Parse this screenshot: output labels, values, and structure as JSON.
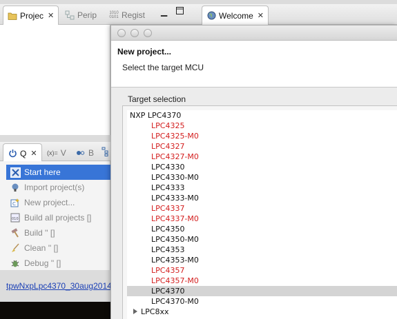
{
  "top_tabs": [
    {
      "label": "Projec",
      "icon": "folder-icon",
      "active": true
    },
    {
      "label": "Perip",
      "icon": "peripherals-icon",
      "active": false
    },
    {
      "label": "Regist",
      "icon": "registers-icon",
      "active": false
    }
  ],
  "welcome_tab": {
    "label": "Welcome",
    "icon": "globe-icon"
  },
  "q_tabs": [
    {
      "label": "Q",
      "icon": "power-icon"
    },
    {
      "label": "V",
      "icon": "variables-icon",
      "prefix": "(x)="
    },
    {
      "label": "B",
      "icon": "breakpoints-icon"
    }
  ],
  "quickstart": {
    "items": [
      {
        "label": "Start here",
        "icon": "start-icon",
        "selected": true
      },
      {
        "label": "Import project(s)",
        "icon": "import-icon"
      },
      {
        "label": "New project...",
        "icon": "new-project-icon"
      },
      {
        "label": "Build all projects []",
        "icon": "build-all-icon"
      },
      {
        "label": "Build '' []",
        "icon": "hammer-icon"
      },
      {
        "label": "Clean '' []",
        "icon": "broom-icon"
      },
      {
        "label": "Debug '' []",
        "icon": "bug-icon"
      }
    ]
  },
  "workspace_link": "tpwNxpLpc4370_30aug2014",
  "dialog": {
    "heading": "New project...",
    "subtitle": "Select the target MCU",
    "group_label": "Target selection",
    "tree": {
      "root": "NXP LPC4370",
      "items": [
        {
          "label": "LPC4325",
          "color": "red"
        },
        {
          "label": "LPC4325-M0",
          "color": "red"
        },
        {
          "label": "LPC4327",
          "color": "red"
        },
        {
          "label": "LPC4327-M0",
          "color": "red"
        },
        {
          "label": "LPC4330",
          "color": "black"
        },
        {
          "label": "LPC4330-M0",
          "color": "black"
        },
        {
          "label": "LPC4333",
          "color": "black"
        },
        {
          "label": "LPC4333-M0",
          "color": "black"
        },
        {
          "label": "LPC4337",
          "color": "red"
        },
        {
          "label": "LPC4337-M0",
          "color": "red"
        },
        {
          "label": "LPC4350",
          "color": "black"
        },
        {
          "label": "LPC4350-M0",
          "color": "black"
        },
        {
          "label": "LPC4353",
          "color": "black"
        },
        {
          "label": "LPC4353-M0",
          "color": "black"
        },
        {
          "label": "LPC4357",
          "color": "red"
        },
        {
          "label": "LPC4357-M0",
          "color": "red"
        },
        {
          "label": "LPC4370",
          "color": "black",
          "selected": true
        },
        {
          "label": "LPC4370-M0",
          "color": "black"
        }
      ],
      "collapsed_group": "LPC8xx"
    }
  },
  "colors": {
    "selection_blue": "#3875d7",
    "unavailable_red": "#d42020",
    "link_blue": "#1a3fb5"
  }
}
